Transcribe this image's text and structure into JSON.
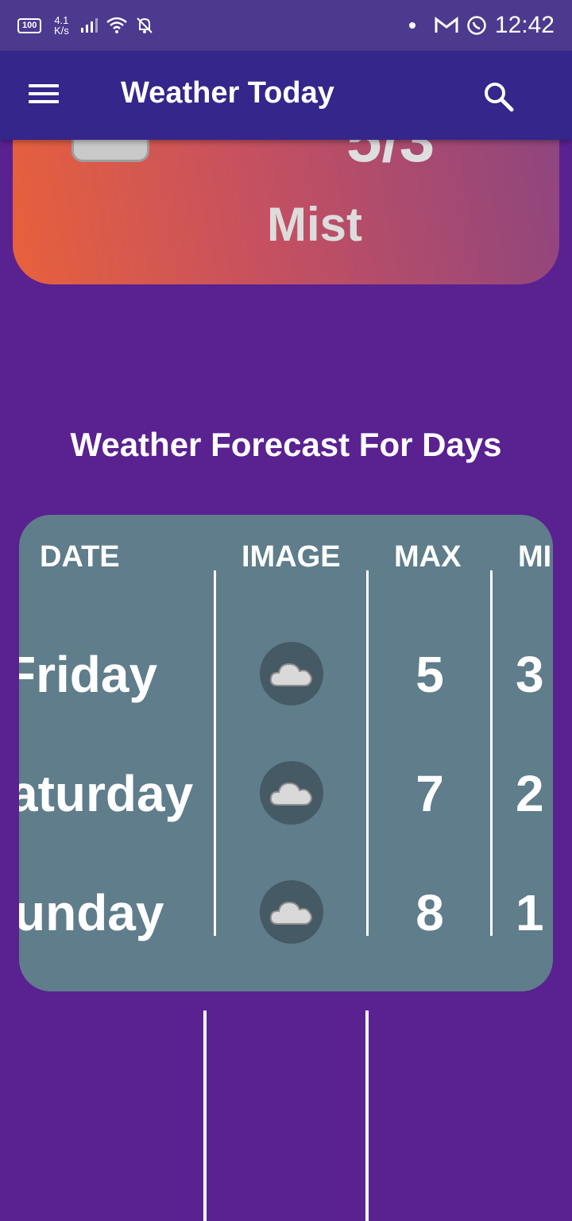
{
  "status_bar": {
    "battery": "100",
    "net_speed_value": "4.1",
    "net_speed_unit": "K/s",
    "time": "12:42",
    "icons": [
      "signal-icon",
      "wifi-icon",
      "mute-icon",
      "gmail-icon",
      "whatsapp-icon"
    ]
  },
  "app_bar": {
    "title": "Weather Today"
  },
  "current": {
    "temp": "5/3",
    "description": "Mist"
  },
  "forecast": {
    "title": "Weather Forecast For Days",
    "headers": {
      "date": "DATE",
      "image": "IMAGE",
      "max": "MAX",
      "min": "MI"
    },
    "rows": [
      {
        "day": "Friday",
        "max": "5",
        "min": "3"
      },
      {
        "day": "aturday",
        "max": "7",
        "min": "2"
      },
      {
        "day": "unday",
        "max": "8",
        "min": "1"
      }
    ]
  },
  "colors": {
    "background": "#5a2191",
    "app_bar": "#34268a",
    "table": "#5f7d8b"
  }
}
